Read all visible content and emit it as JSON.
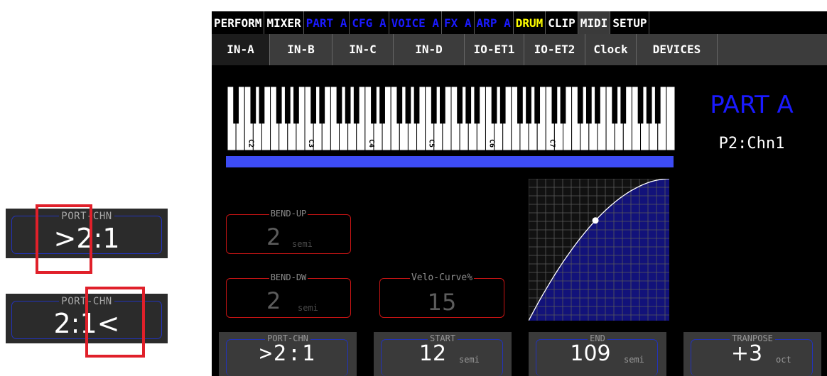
{
  "insets": [
    {
      "legend": "PORT-CHN",
      "value": ">2:1"
    },
    {
      "legend": "PORT-CHN",
      "value": "2:1<"
    }
  ],
  "top_tabs": [
    {
      "label": "PERFORM",
      "color": "white"
    },
    {
      "label": "MIXER",
      "color": "white"
    },
    {
      "label": "PART A",
      "color": "blue"
    },
    {
      "label": "CFG A",
      "color": "blue"
    },
    {
      "label": "VOICE A",
      "color": "blue"
    },
    {
      "label": "FX A",
      "color": "blue"
    },
    {
      "label": "ARP A",
      "color": "blue"
    },
    {
      "label": "DRUM",
      "color": "yellow"
    },
    {
      "label": "CLIP",
      "color": "white"
    },
    {
      "label": "MIDI",
      "color": "white",
      "active": true
    },
    {
      "label": "SETUP",
      "color": "white"
    }
  ],
  "sub_tabs": [
    {
      "label": "IN-A",
      "active": true
    },
    {
      "label": "IN-B"
    },
    {
      "label": "IN-C"
    },
    {
      "label": "IN-D"
    },
    {
      "label": "IO-ET1"
    },
    {
      "label": "IO-ET2"
    },
    {
      "label": "Clock"
    },
    {
      "label": "DEVICES"
    }
  ],
  "keyboard": {
    "octave_labels": [
      "C2",
      "C3",
      "C4",
      "C5",
      "C6",
      "C7"
    ]
  },
  "part": {
    "title": "PART A",
    "channel": "P2:Chn1"
  },
  "bend_up": {
    "label": "BEND-UP",
    "value": "2",
    "unit": "semi"
  },
  "bend_dw": {
    "label": "BEND-DW",
    "value": "2",
    "unit": "semi"
  },
  "velo_curve": {
    "label": "Velo-Curve%",
    "value": "15"
  },
  "bottom": {
    "port_chn": {
      "label": "PORT-CHN",
      "value": ">2:1"
    },
    "start": {
      "label": "START",
      "value": "12",
      "unit": "semi"
    },
    "end": {
      "label": "END",
      "value": "109",
      "unit": "semi"
    },
    "transpose": {
      "label": "TRANPOSE",
      "value": "+3",
      "unit": "oct"
    }
  },
  "colors": {
    "accent_blue": "#1a1aff",
    "highlight_red": "#e0202a",
    "bar_blue": "#3d4cf5",
    "curve_fill": "#12127a"
  }
}
